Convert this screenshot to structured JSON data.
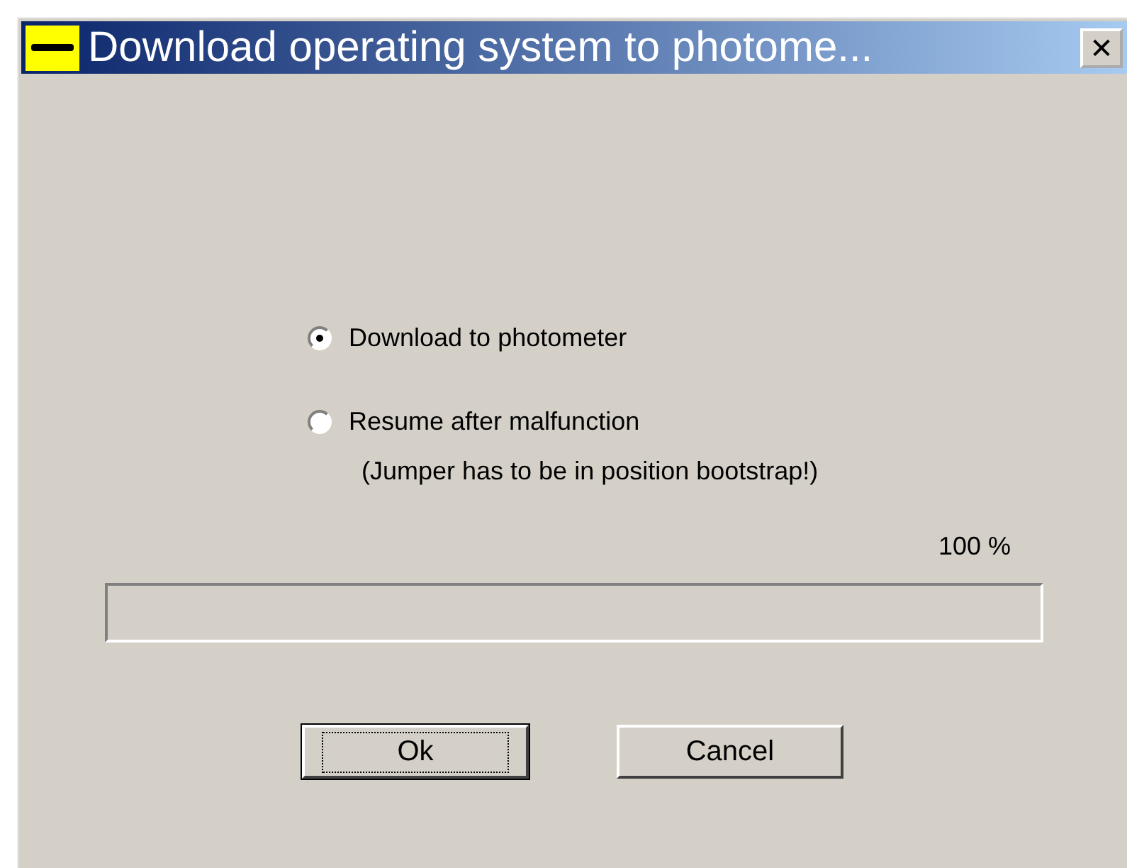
{
  "window": {
    "title": "Download operating system to photome...",
    "close": "✕"
  },
  "options": [
    {
      "label": "Download to photometer",
      "selected": true
    },
    {
      "label": "Resume after malfunction",
      "selected": false
    }
  ],
  "note": "(Jumper has to be in position bootstrap!)",
  "progress": {
    "reading": "100 %"
  },
  "buttons": [
    {
      "label": "Ok",
      "default": true
    },
    {
      "label": "Cancel",
      "default": false
    }
  ]
}
